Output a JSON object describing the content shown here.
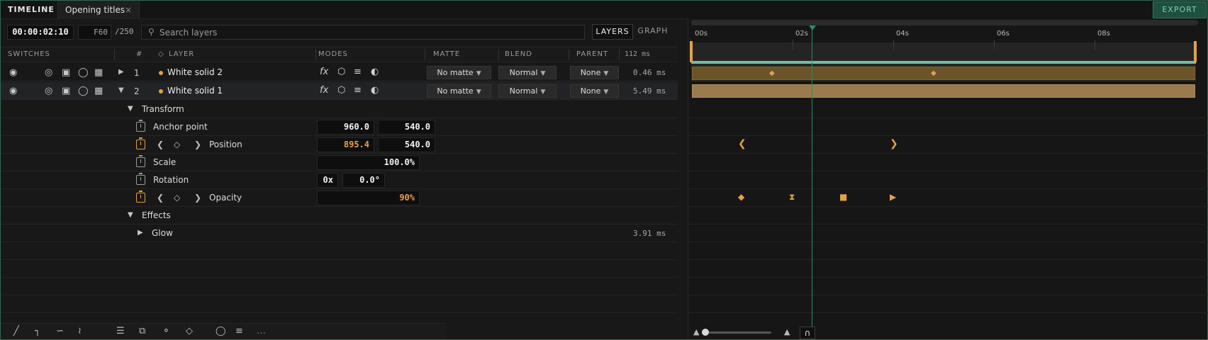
{
  "tabs": {
    "panel": "TIMELINE",
    "doc": "Opening titles",
    "close": "×",
    "export": "EXPORT"
  },
  "toolbar": {
    "timecode": "00:00:02:10",
    "frame": "F60",
    "frame_total": "/250",
    "search_placeholder": "Search layers",
    "view_layers": "LAYERS",
    "view_graph": "GRAPH"
  },
  "header": {
    "switches": "SWITCHES",
    "num": "#",
    "layer": "LAYER",
    "modes": "MODES",
    "matte": "MATTE",
    "blend": "BLEND",
    "parent": "PARENT",
    "total_ms": "112 ms"
  },
  "layers": [
    {
      "num": "1",
      "name": "White solid 2",
      "matte": "No matte",
      "blend": "Normal",
      "parent": "None",
      "ms": "0.46 ms",
      "expanded": false
    },
    {
      "num": "2",
      "name": "White solid 1",
      "matte": "No matte",
      "blend": "Normal",
      "parent": "None",
      "ms": "5.49 ms",
      "expanded": true
    }
  ],
  "transform": {
    "group": "Transform",
    "anchor": {
      "label": "Anchor point",
      "x": "960.0",
      "y": "540.0"
    },
    "position": {
      "label": "Position",
      "x": "895.4",
      "y": "540.0"
    },
    "scale": {
      "label": "Scale",
      "value": "100.0%"
    },
    "rotation": {
      "label": "Rotation",
      "turns": "0x",
      "deg": "0.0°"
    },
    "opacity": {
      "label": "Opacity",
      "value": "90%"
    }
  },
  "effects": {
    "group": "Effects",
    "glow": {
      "label": "Glow",
      "ms": "3.91 ms"
    }
  },
  "ruler": [
    "00s",
    "02s",
    "04s",
    "06s",
    "08s"
  ],
  "colors": {
    "accent": "#2f8a63",
    "keyframe": "#e2a24a",
    "workbar": "#6fbfa0"
  }
}
